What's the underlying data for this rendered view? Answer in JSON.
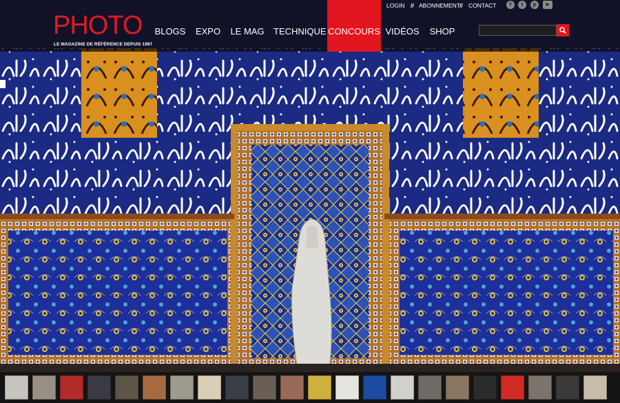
{
  "brand": {
    "logo": "PHOTO",
    "tagline": "LE MAGAZINE DE RÉFÉRENCE DEPUIS 1967",
    "accent": "#e3151e"
  },
  "utility_nav": {
    "login": "LOGIN",
    "separator": "//",
    "subscription": "ABONNEMENT",
    "contact": "CONTACT"
  },
  "social_icons": [
    "facebook-icon",
    "twitter-icon",
    "pinterest-icon",
    "youtube-icon"
  ],
  "nav": [
    {
      "label": "BLOGS",
      "active": false
    },
    {
      "label": "EXPO",
      "active": false
    },
    {
      "label": "LE MAG",
      "active": false
    },
    {
      "label": "TECHNIQUE",
      "active": false
    },
    {
      "label": "CONCOURS",
      "active": true
    },
    {
      "label": "VIDÉOS",
      "active": false
    },
    {
      "label": "SHOP",
      "active": false
    }
  ],
  "search": {
    "placeholder": "",
    "value": "",
    "icon": "search-icon"
  },
  "thumbnails": [
    {
      "color": "#c8c4be"
    },
    {
      "color": "#9a8f84"
    },
    {
      "color": "#b32a2a"
    },
    {
      "color": "#3b3a44"
    },
    {
      "color": "#5e5549"
    },
    {
      "color": "#a56b3f"
    },
    {
      "color": "#9d9a8e"
    },
    {
      "color": "#d8cfb5"
    },
    {
      "color": "#3a3e46"
    },
    {
      "color": "#6a5f55"
    },
    {
      "color": "#9a6a58"
    },
    {
      "color": "#cdb13c"
    },
    {
      "color": "#e6e4de"
    },
    {
      "color": "#1d4ba3"
    },
    {
      "color": "#d2d0ca"
    },
    {
      "color": "#6d6b64"
    },
    {
      "color": "#8b7662"
    },
    {
      "color": "#2c2c2c"
    },
    {
      "color": "#cf2a23"
    },
    {
      "color": "#7c736a"
    },
    {
      "color": "#3c3a38"
    },
    {
      "color": "#c9bba9"
    }
  ]
}
